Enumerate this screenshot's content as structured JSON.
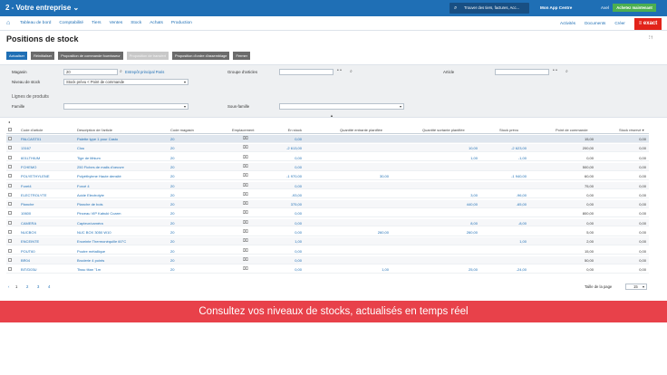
{
  "topbar": {
    "company": "2 - Votre entreprise ⌄",
    "search_placeholder": "Trouver des tiers, factures, Acc...",
    "app_centre": "Mon App Centre",
    "avatar": "Axel",
    "buy_now": "Achetez maintenant"
  },
  "nav": {
    "items": [
      "Tableau de bord",
      "Comptabilité",
      "Tiers",
      "Ventes",
      "Stock",
      "Achats",
      "Production"
    ],
    "right": [
      "Activités",
      "Documents",
      "Créer"
    ]
  },
  "logo": "≡ exact",
  "page": {
    "title": "Positions de stock"
  },
  "toolbar": {
    "buttons": [
      "Actualiser",
      "Réinitialiser",
      "Proposition de commande fournisseur",
      "Proposition de transfert",
      "Proposition d'ordre d'assemblage",
      "Fermer"
    ]
  },
  "filters": {
    "magasin_label": "Magasin",
    "magasin_value": "20",
    "magasin_link": "Entrepôt principal Paris",
    "niveau_label": "Niveau de stock",
    "niveau_value": "Stock prévu < Point de commande",
    "groupe_label": "Groupe d'articles",
    "article_label": "Article",
    "lignes_label": "Lignes de produits",
    "famille_label": "Famille",
    "sousfamille_label": "Sous-famille"
  },
  "table": {
    "headers": [
      "Code d'article",
      "Description de l'article",
      "Code magasin",
      "Emplacement",
      "En stock",
      "Quantité entrante planifiée",
      "Quantité sortante planifiée",
      "Stock prévu",
      "Point de commande",
      "Stock réservé ▾"
    ],
    "rows": [
      [
        "PALCAST01",
        "Palette type 1 pour Casto",
        "20",
        "0,00",
        "",
        "",
        "",
        "15,00",
        "0,00"
      ],
      [
        "13167",
        "Clou",
        "20",
        "-2 613,00",
        "",
        "10,00",
        "-2 623,00",
        "200,00",
        "0,00"
      ],
      [
        "601LTHIUM",
        "Tige de lithium",
        "20",
        "0,00",
        "",
        "1,00",
        "-1,00",
        "0,00",
        "0,00"
      ],
      [
        "FCHEMO",
        "250 Fiches de mails d'oeuvre",
        "20",
        "0,00",
        "",
        "",
        "",
        "500,00",
        "0,00"
      ],
      [
        "POLYETHYLENE",
        "Polyéthylene Haute densité",
        "20",
        "-1 970,00",
        "30,00",
        "",
        "-1 940,00",
        "60,00",
        "0,00"
      ],
      [
        "Foret4",
        "Forcé 4",
        "20",
        "0,00",
        "",
        "",
        "",
        "75,00",
        "0,00"
      ],
      [
        "ELECTROLYTE",
        "Acide Electrolyte",
        "20",
        "-93,00",
        "",
        "3,00",
        "-96,00",
        "0,00",
        "0,00"
      ],
      [
        "Planche",
        "Planche de bois",
        "20",
        "375,00",
        "",
        "440,00",
        "-65,00",
        "0,00",
        "0,00"
      ],
      [
        "10600",
        "Pinceau VIP Kabuki Coarm",
        "20",
        "0,00",
        "",
        "",
        "",
        "800,00",
        "0,00"
      ],
      [
        "CAMERA",
        "Capteur/caméra",
        "20",
        "0,00",
        "",
        "8,00",
        "-8,00",
        "0,00",
        "0,00"
      ],
      [
        "NUCBOX",
        "NUC BOX 3050 W10",
        "20",
        "0,00",
        "260,00",
        "260,00",
        "",
        "5,00",
        "0,00"
      ],
      [
        "ENCEINTE",
        "Enceinte Thermonéquille 60°C",
        "20",
        "1,00",
        "",
        "",
        "1,00",
        "2,00",
        "0,00"
      ],
      [
        "POUT60",
        "Poutre métallique",
        "20",
        "0,00",
        "",
        "",
        "",
        "15,00",
        "0,00"
      ],
      [
        "BR04",
        "Broderie 4 points",
        "20",
        "0,00",
        "",
        "",
        "",
        "50,00",
        "0,00"
      ],
      [
        "BIT/D03U",
        "Tissu titan \"1m",
        "20",
        "0,00",
        "1,00",
        "25,00",
        "-24,00",
        "0,00",
        "0,00"
      ]
    ]
  },
  "pager": {
    "pages": [
      "1",
      "2",
      "3",
      "4"
    ],
    "size_label": "Taille de la page",
    "size_value": "15"
  },
  "banner": "Consultez vos niveaux de stocks, actualisés en temps réel",
  "colors": {
    "primary": "#1f6fb5",
    "banner": "#e8414a",
    "logo": "#e2231a",
    "buy": "#4caf50"
  }
}
